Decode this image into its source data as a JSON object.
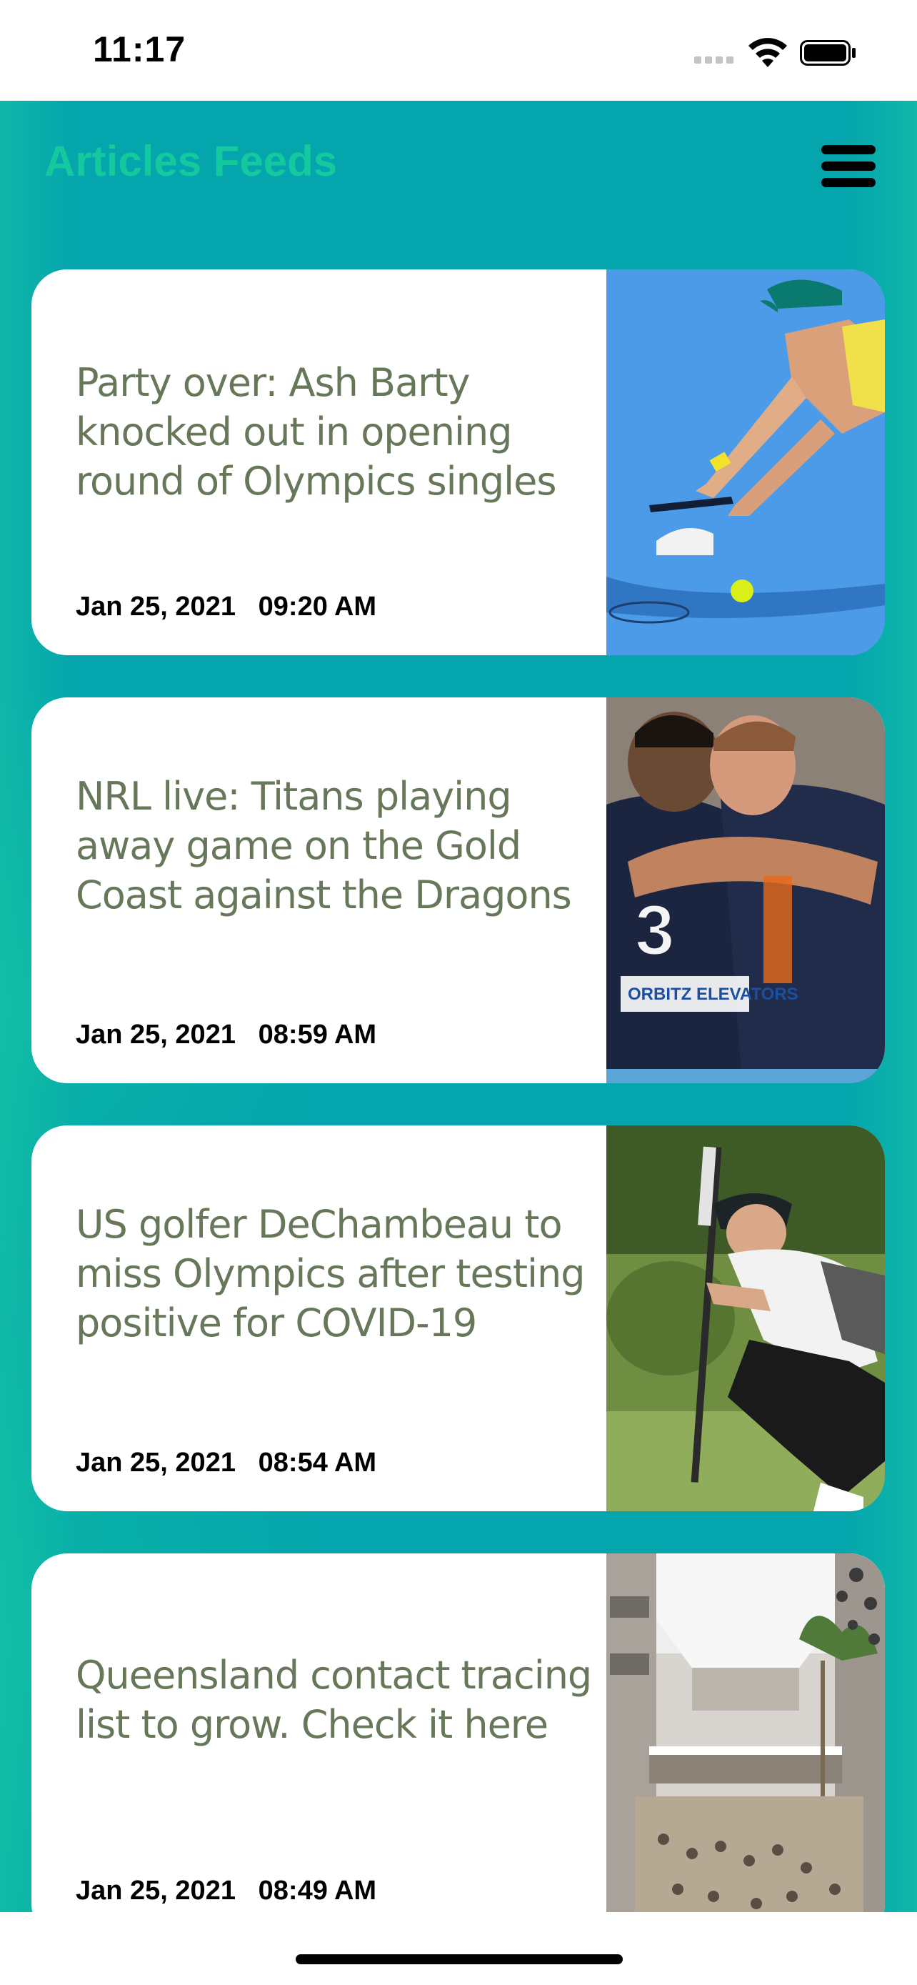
{
  "status_bar": {
    "time": "11:17"
  },
  "header": {
    "title": "Articles Feeds",
    "menu_icon": "hamburger-menu-icon"
  },
  "articles": [
    {
      "title": "Party over: Ash Barty knocked out in opening round of Olympics singles",
      "date": "Jan 25, 2021",
      "time": "09:20 AM",
      "image": "tennis-player-photo"
    },
    {
      "title": "NRL live: Titans playing away game on the Gold Coast against the Dragons",
      "date": "Jan 25, 2021",
      "time": "08:59 AM",
      "image": "rugby-players-photo",
      "jersey_number": "3",
      "sponsor": "ORBITZ ELEVATORS"
    },
    {
      "title": "US golfer DeChambeau to miss Olympics after testing positive for COVID-19",
      "date": "Jan 25, 2021",
      "time": "08:54 AM",
      "image": "golfer-photo"
    },
    {
      "title": "Queensland contact tracing list to grow. Check it here",
      "date": "Jan 25, 2021",
      "time": "08:49 AM",
      "image": "shopping-mall-photo"
    }
  ],
  "colors": {
    "background": "#04a5ac",
    "title_accent": "#14c99d",
    "headline_text": "#66775a"
  }
}
